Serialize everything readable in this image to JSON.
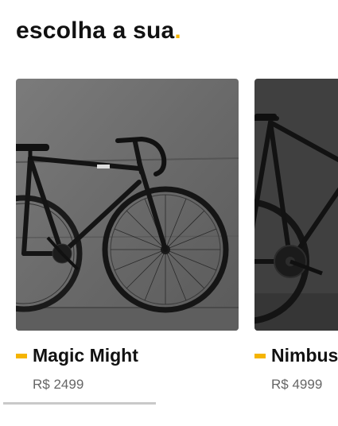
{
  "heading": {
    "text": "escolha a sua",
    "accent_dot": "."
  },
  "products": [
    {
      "name": "Magic Might",
      "price": "R$ 2499"
    },
    {
      "name": "Nimbus",
      "price": "R$ 4999"
    }
  ],
  "colors": {
    "accent": "#f5b400",
    "text": "#111111",
    "price": "#666666"
  }
}
